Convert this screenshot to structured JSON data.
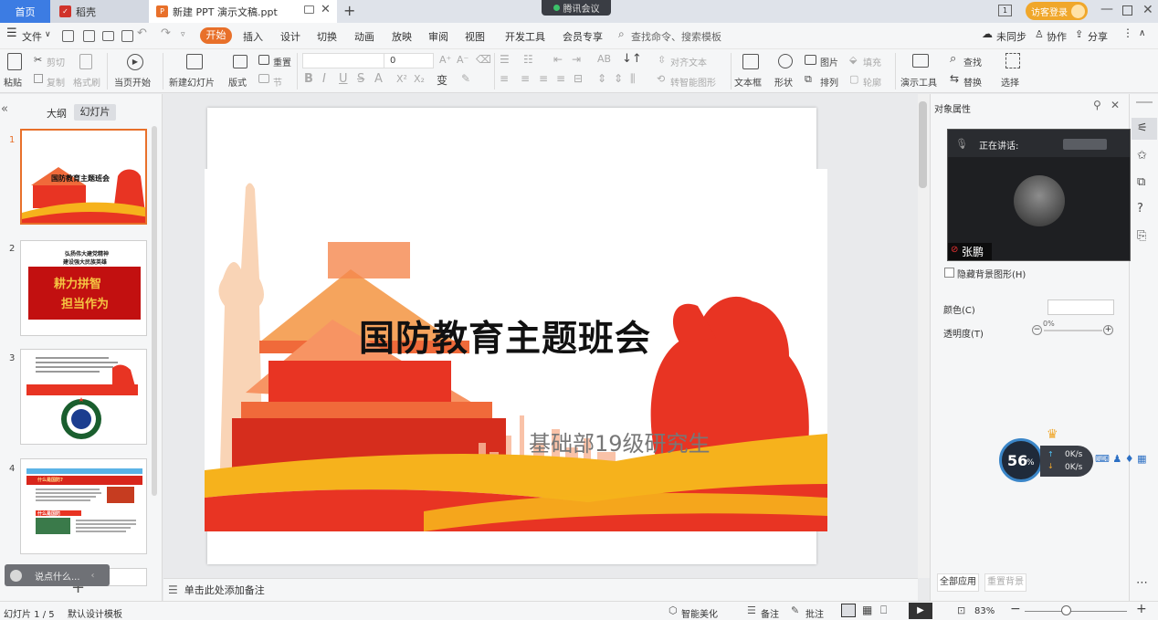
{
  "tabs": {
    "home": "首页",
    "daoke": "稻壳",
    "doc": "新建 PPT 演示文稿.ppt",
    "new_tab": "+"
  },
  "meeting_badge": "腾讯会议",
  "titlebar_right": {
    "visitor_login": "访客登录",
    "page_icon": "1"
  },
  "menu": {
    "file": "文件",
    "start": "开始",
    "items": [
      "插入",
      "设计",
      "切换",
      "动画",
      "放映",
      "审阅",
      "视图",
      "开发工具",
      "会员专享"
    ],
    "search": "查找命令、搜索模板",
    "unsync": "未同步",
    "collab": "协作",
    "share": "分享"
  },
  "toolbar": {
    "paste": "粘贴",
    "cut": "剪切",
    "copy": "复制",
    "format_painter": "格式刷",
    "from_current": "当页开始",
    "new_slide": "新建幻灯片",
    "layout": "版式",
    "reset": "重置",
    "section": "节",
    "font_size": "0",
    "align_text": "对齐文本",
    "smart_art": "转智能图形",
    "textbox": "文本框",
    "shape": "形状",
    "picture": "图片",
    "arrange": "排列",
    "fill": "填充",
    "outline": "轮廓",
    "present_tools": "演示工具",
    "find": "查找",
    "replace": "替换",
    "select": "选择"
  },
  "left_panel": {
    "outline_tab": "大纲",
    "slides_tab": "幻灯片",
    "slide_numbers": [
      "1",
      "2",
      "3",
      "4"
    ],
    "thumb1_title": "国防教育主题班会",
    "thumb2_title_line1": "弘扬伟大建党精神",
    "thumb2_title_line2": "建设强大民族英雄",
    "thumb2_banner_line1": "耕力拼智",
    "thumb2_banner_line2": "担当作为",
    "thumb4_heading": "什么是国防?",
    "thumb4_sub": "什么是国防"
  },
  "slide": {
    "title": "国防教育主题班会",
    "subtitle": "基础部19级研究生"
  },
  "notes": {
    "placeholder": "单击此处添加备注"
  },
  "right_panel": {
    "title": "对象属性",
    "hide_bg": "隐藏背景图形(H)",
    "color": "颜色(C)",
    "transparency": "透明度(T)",
    "transparency_value": "0%",
    "apply_all": "全部应用",
    "reset_bg": "重置背景"
  },
  "video": {
    "speaking": "正在讲话:",
    "name": "张鹏"
  },
  "speed": {
    "percent": "56",
    "unit": "%",
    "up": "0K/s",
    "down": "0K/s"
  },
  "chat_bubble": "说点什么...",
  "status": {
    "slide_info": "幻灯片 1 / 5",
    "template": "默认设计模板",
    "smart_beautify": "智能美化",
    "notes": "备注",
    "comments": "批注",
    "zoom": "83%"
  },
  "colors": {
    "accent": "#e8702a",
    "blue_tab": "#3c7ce3",
    "slide_red": "#e83423",
    "slide_yellow": "#f6b21c"
  }
}
